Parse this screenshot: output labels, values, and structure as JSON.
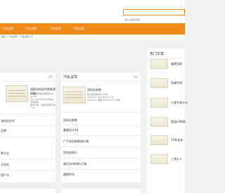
{
  "search": {
    "placeholder": "输入关键词搜索..."
  },
  "nav": [
    "汽车技术",
    "汽车试驾",
    "汽车资讯",
    "汽车文化"
  ],
  "breadcrumb": "首页 > 汽车品牌 > 汽车品牌大全",
  "left_panel": {
    "more": "更多",
    "featured": {
      "title": "道奥油电混合新能源价格",
      "desc": [
        "道奥油电混合新能源汽车12.98",
        "万元-16.58万元之间左右的新能源",
        "电动汽车，道奥新能源汽车1.47"
      ]
    },
    "links": [
      "油电混合车",
      "品牌",
      "牌大全",
      "大排名",
      "国产车"
    ]
  },
  "mid_panel": {
    "title": "汽车试驾",
    "more": "更多",
    "featured": {
      "title": "凯科丝参数",
      "desc": [
        "凯科丝轻客车尺寸为长",
        "4990mm, 宽1790mm, 高",
        "1945mm, 轴距为2570mm。外观"
      ]
    },
    "links": [
      "凯科丝参数",
      "嘉越宝马X6",
      "广汽本田新能源价格",
      "凯科丝旅行",
      "捷达sk4新款以7座",
      "越野的车"
    ]
  },
  "sidebar": {
    "title": "热门文章",
    "items": [
      "福建西联",
      "凯越空调",
      "七座车有什么",
      "奥迪a3新款",
      "15年长安",
      "上海九+"
    ]
  }
}
